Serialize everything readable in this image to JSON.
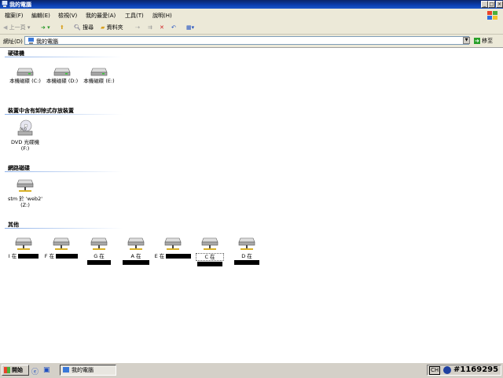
{
  "window": {
    "title": "我的電腦"
  },
  "menu": [
    "檔案(F)",
    "編輯(E)",
    "檢視(V)",
    "我的最愛(A)",
    "工具(T)",
    "說明(H)"
  ],
  "toolbar": {
    "back": "上一頁",
    "search": "搜尋",
    "folders": "資料夾"
  },
  "address": {
    "label": "網址(D)",
    "value": "我的電腦",
    "go": "移至"
  },
  "sections": {
    "hard_drives": {
      "title": "硬碟機",
      "items": [
        "本機磁碟 (C:)",
        "本機磁碟 (D:)",
        "本機磁碟 (E:)"
      ]
    },
    "removable": {
      "title": "裝置中含有卸除式存放裝置",
      "items": [
        {
          "line1": "DVD 光碟機",
          "line2": "(F:)"
        }
      ]
    },
    "network": {
      "title": "網路磁碟",
      "items": [
        {
          "line1": "stm 於 'web2'",
          "line2": "(Z:)"
        }
      ]
    },
    "other": {
      "title": "其他",
      "items": [
        "I 在",
        "F 在",
        "G 在",
        "A 在",
        "E 在",
        "C 在",
        "D 在"
      ]
    }
  },
  "taskbar": {
    "start": "開始",
    "task": "我的電腦",
    "tray_ime": "CH",
    "tray_id": "#1169295"
  },
  "icons": {
    "app": "computer-icon",
    "drive": "hard-drive-icon",
    "dvd": "dvd-drive-icon",
    "net": "network-drive-icon",
    "back": "back-arrow-icon",
    "forward": "forward-arrow-icon",
    "up": "up-folder-icon",
    "search": "search-icon",
    "folders": "folders-icon"
  },
  "colors": {
    "titlebar": "#0a246a",
    "chrome": "#ece9d8",
    "accent": "#8cb0e8"
  }
}
